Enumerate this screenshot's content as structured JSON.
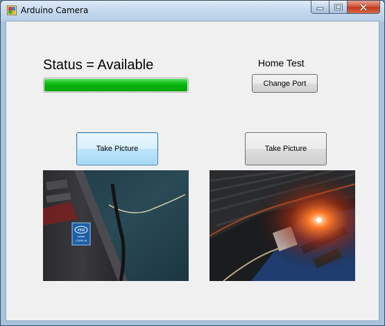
{
  "window": {
    "title": "Arduino Camera",
    "minimize_glyph": "‒",
    "maximize_glyph": "□",
    "close_glyph": "✕"
  },
  "status": {
    "label": "Status = Available",
    "progress_fraction": 1.0,
    "progress_color": "#0ab00e"
  },
  "port": {
    "name_label": "Home Test",
    "change_button": "Change Port"
  },
  "cameras": [
    {
      "take_button": "Take Picture",
      "photo_icon": "camera-photo-laptop-intel-sticker"
    },
    {
      "take_button": "Take Picture",
      "photo_icon": "camera-photo-arduino-board-led"
    }
  ],
  "sticker_text": {
    "brand": "intel",
    "line1": "inside",
    "line2": "CORE i5"
  }
}
